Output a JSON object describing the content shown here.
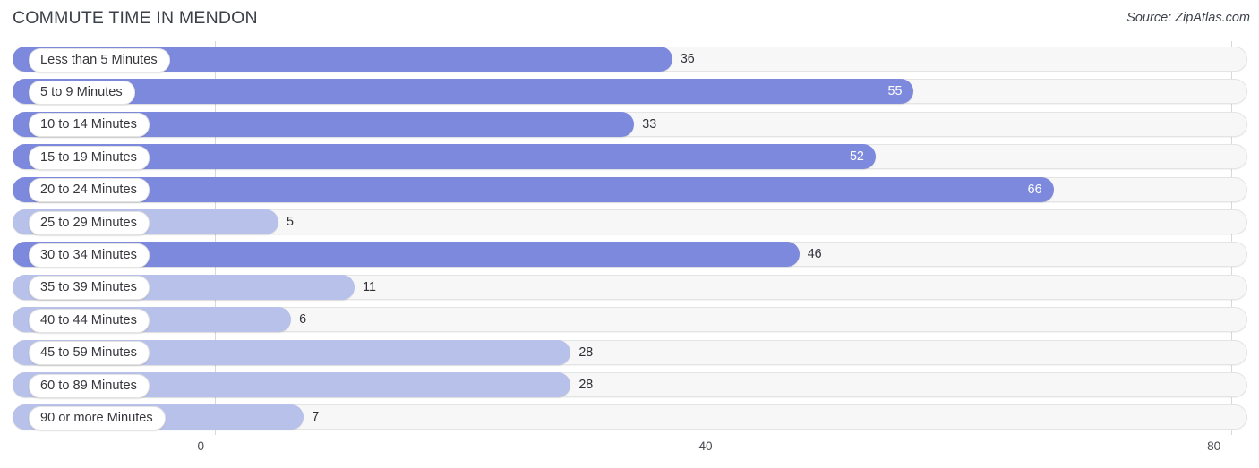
{
  "header": {
    "title": "COMMUTE TIME IN MENDON",
    "source": "Source: ZipAtlas.com"
  },
  "chart_data": {
    "type": "bar",
    "orientation": "horizontal",
    "title": "COMMUTE TIME IN MENDON",
    "xlabel": "",
    "ylabel": "",
    "xlim": [
      0,
      80
    ],
    "xticks": [
      0,
      40,
      80
    ],
    "xtick_labels": [
      "0",
      "40",
      "80"
    ],
    "grid": true,
    "legend": false,
    "colors": {
      "bar_high": "#7d89dc",
      "bar_low": "#b8c1e9",
      "track": "#f7f7f7",
      "gridline": "#d8d8d8",
      "label_text": "#36363c",
      "value_text_outside": "#2f3036",
      "value_text_inside": "#ffffff"
    },
    "categories": [
      "Less than 5 Minutes",
      "5 to 9 Minutes",
      "10 to 14 Minutes",
      "15 to 19 Minutes",
      "20 to 24 Minutes",
      "25 to 29 Minutes",
      "30 to 34 Minutes",
      "35 to 39 Minutes",
      "40 to 44 Minutes",
      "45 to 59 Minutes",
      "60 to 89 Minutes",
      "90 or more Minutes"
    ],
    "values": [
      36,
      55,
      33,
      52,
      66,
      5,
      46,
      11,
      6,
      28,
      28,
      7
    ],
    "value_labels": [
      "36",
      "55",
      "33",
      "52",
      "66",
      "5",
      "46",
      "11",
      "6",
      "28",
      "28",
      "7"
    ],
    "bars": [
      {
        "label": "Less than 5 Minutes",
        "value": 36,
        "value_label": "36",
        "shade": "hi",
        "label_inside": false
      },
      {
        "label": "5 to 9 Minutes",
        "value": 55,
        "value_label": "55",
        "shade": "hi",
        "label_inside": true
      },
      {
        "label": "10 to 14 Minutes",
        "value": 33,
        "value_label": "33",
        "shade": "hi",
        "label_inside": false
      },
      {
        "label": "15 to 19 Minutes",
        "value": 52,
        "value_label": "52",
        "shade": "hi",
        "label_inside": true
      },
      {
        "label": "20 to 24 Minutes",
        "value": 66,
        "value_label": "66",
        "shade": "hi",
        "label_inside": true
      },
      {
        "label": "25 to 29 Minutes",
        "value": 5,
        "value_label": "5",
        "shade": "lo",
        "label_inside": false
      },
      {
        "label": "30 to 34 Minutes",
        "value": 46,
        "value_label": "46",
        "shade": "hi",
        "label_inside": false
      },
      {
        "label": "35 to 39 Minutes",
        "value": 11,
        "value_label": "11",
        "shade": "lo",
        "label_inside": false
      },
      {
        "label": "40 to 44 Minutes",
        "value": 6,
        "value_label": "6",
        "shade": "lo",
        "label_inside": false
      },
      {
        "label": "45 to 59 Minutes",
        "value": 28,
        "value_label": "28",
        "shade": "lo",
        "label_inside": false
      },
      {
        "label": "60 to 89 Minutes",
        "value": 28,
        "value_label": "28",
        "shade": "lo",
        "label_inside": false
      },
      {
        "label": "90 or more Minutes",
        "value": 7,
        "value_label": "7",
        "shade": "lo",
        "label_inside": false
      }
    ]
  }
}
